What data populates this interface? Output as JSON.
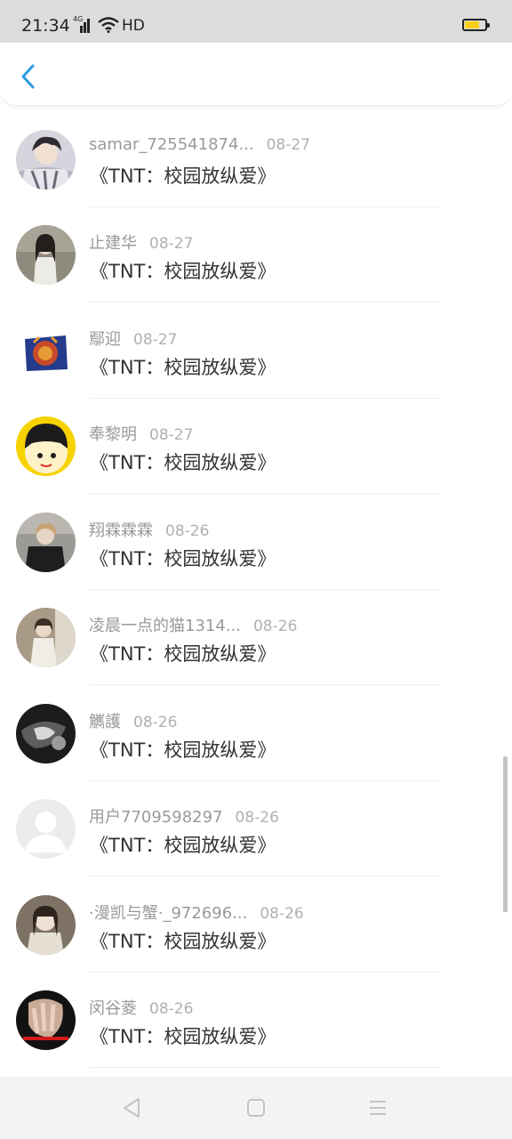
{
  "status_bar": {
    "time": "21:34",
    "network": "4G",
    "hd": "HD",
    "icons": [
      "signal-icon",
      "wifi-icon",
      "battery-icon"
    ],
    "battery_level": 0.6,
    "battery_color": "#f5cf1a"
  },
  "header": {
    "back_icon": "chevron-left-icon",
    "accent": "#2b9de4"
  },
  "items": [
    {
      "username": "samar_725541874...",
      "date": "08-27",
      "book": "《TNT：校园放纵爱》"
    },
    {
      "username": "止建华",
      "date": "08-27",
      "book": "《TNT：校园放纵爱》"
    },
    {
      "username": "鄢迎",
      "date": "08-27",
      "book": "《TNT：校园放纵爱》"
    },
    {
      "username": "奉黎明",
      "date": "08-27",
      "book": "《TNT：校园放纵爱》"
    },
    {
      "username": "翔霖霖霖",
      "date": "08-26",
      "book": "《TNT：校园放纵爱》"
    },
    {
      "username": "凌晨一点的猫1314...",
      "date": "08-26",
      "book": "《TNT：校园放纵爱》"
    },
    {
      "username": "觽護",
      "date": "08-26",
      "book": "《TNT：校园放纵爱》"
    },
    {
      "username": "用户7709598297",
      "date": "08-26",
      "book": "《TNT：校园放纵爱》"
    },
    {
      "username": "·漫凯与蟹·_972696...",
      "date": "08-26",
      "book": "《TNT：校园放纵爱》"
    },
    {
      "username": "闵谷菱",
      "date": "08-26",
      "book": "《TNT：校园放纵爱》"
    }
  ],
  "navbar": {
    "icons": [
      "back-triangle-icon",
      "home-square-icon",
      "menu-lines-icon"
    ]
  }
}
